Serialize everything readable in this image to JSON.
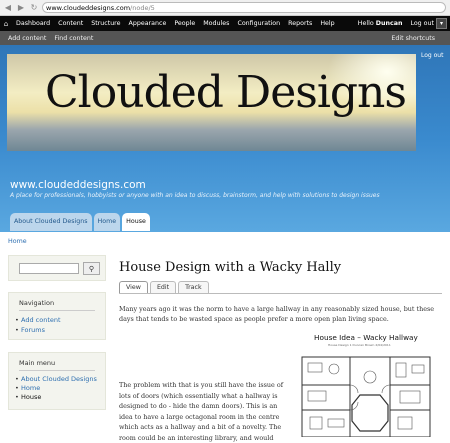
{
  "browser": {
    "url_main": "www.cloudeddesigns.com",
    "url_rest": "/node/5"
  },
  "toolbar": {
    "menu": [
      "Dashboard",
      "Content",
      "Structure",
      "Appearance",
      "People",
      "Modules",
      "Configuration",
      "Reports",
      "Help"
    ],
    "hello": "Hello",
    "user": "Duncan",
    "logout": "Log out"
  },
  "shortcuts": {
    "items": [
      "Add content",
      "Find content"
    ],
    "edit": "Edit shortcuts"
  },
  "header": {
    "banner_title": "Clouded Designs",
    "logout_partial": "Log out",
    "site_name": "www.cloudeddesigns.com",
    "slogan": "A place for professionals, hobbyists or anyone with an idea to discuss, brainstorm, and help with solutions to design issues",
    "tabs": [
      "About Clouded Designs",
      "Home",
      "House"
    ],
    "active_tab": "House"
  },
  "breadcrumb": "Home",
  "sidebar": {
    "navigation": {
      "title": "Navigation",
      "items": [
        "Add content",
        "Forums"
      ]
    },
    "main_menu": {
      "title": "Main menu",
      "items": [
        "About Clouded Designs",
        "Home",
        "House"
      ]
    }
  },
  "content": {
    "title": "House Design with a Wacky Hally",
    "tabs": [
      "View",
      "Edit",
      "Track"
    ],
    "active_tab": "View",
    "para1": "Many years ago it was the norm to have a large hallway in any reasonably sized house, but these days that tends to be wasted space as people prefer a more open plan living space.",
    "para2": "The problem with that is you still have the issue of lots of doors (which essentially what a hallway is designed to do - hide the damn doors). This is an idea to have a large octagonal room in the centre which acts as a hallway and a bit of a novelty. The room could be an interesting library, and would",
    "figure_title": "House Idea – Wacky Hallway",
    "figure_subtitle": "House Design 1 Duncan Brown 2/04/2011"
  }
}
